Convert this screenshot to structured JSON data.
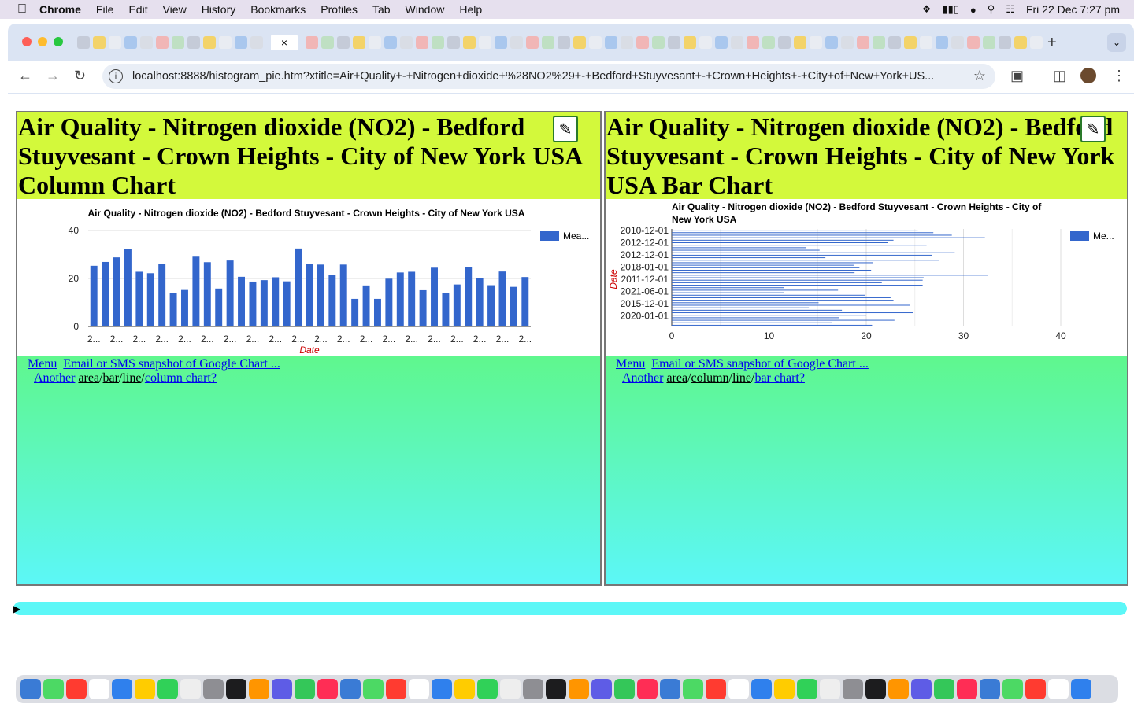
{
  "menubar": {
    "app": "Chrome",
    "items": [
      "File",
      "Edit",
      "View",
      "History",
      "Bookmarks",
      "Profiles",
      "Tab",
      "Window",
      "Help"
    ],
    "clock": "Fri 22 Dec  7:27 pm"
  },
  "browser": {
    "url": "localhost:8888/histogram_pie.htm?xtitle=Air+Quality+-+Nitrogen+dioxide+%28NO2%29+-+Bedford+Stuyvesant+-+Crown+Heights+-+City+of+New+York+US...",
    "tab_close": "×",
    "new_tab": "+"
  },
  "left_panel": {
    "heading": "Air Quality - Nitrogen dioxide (NO2) - Bedford Stuyvesant - Crown Heights - City of New York USA Column Chart",
    "menu_link": "Menu",
    "email_link": "Email or SMS snapshot of Google Chart ...",
    "another_prefix": "Another",
    "alt_area": "area",
    "alt_bar": "bar",
    "alt_line": "line",
    "alt_last": "column chart?",
    "sep": "/"
  },
  "right_panel": {
    "heading": "Air Quality - Nitrogen dioxide (NO2) - Bedford Stuyvesant - Crown Heights - City of New York USA Bar Chart",
    "menu_link": "Menu",
    "email_link": "Email or SMS snapshot of Google Chart ...",
    "another_prefix": "Another",
    "alt_area": "area",
    "alt_column": "column",
    "alt_line": "line",
    "alt_last": "bar chart?",
    "sep": "/"
  },
  "colors": {
    "bar": "#3366cc",
    "title_bg": "#d3f93b",
    "axis_label": "#cc0000"
  },
  "chart_data": [
    {
      "type": "bar",
      "orientation": "vertical",
      "title": "Air Quality - Nitrogen dioxide (NO2) - Bedford Stuyvesant - Crown Heights - City of New York USA",
      "xlabel": "Date",
      "ylabel": "",
      "ylim": [
        0,
        40
      ],
      "yticks": [
        0,
        20,
        40
      ],
      "tick_label": "2...",
      "legend": "Mea...",
      "legend_position": "right",
      "values": [
        25.3,
        26.9,
        28.8,
        32.2,
        22.8,
        22.2,
        26.2,
        13.8,
        15.2,
        29.1,
        26.8,
        15.8,
        27.5,
        20.7,
        18.7,
        19.3,
        20.5,
        18.8,
        32.5,
        25.9,
        25.8,
        21.6,
        25.8,
        11.5,
        17.1,
        11.5,
        19.9,
        22.5,
        22.8,
        15.1,
        24.5,
        14.1,
        17.5,
        24.8,
        20.0,
        17.2,
        22.9,
        16.5,
        20.6
      ],
      "grid": true
    },
    {
      "type": "bar",
      "orientation": "horizontal",
      "title": "Air Quality - Nitrogen dioxide (NO2) - Bedford Stuyvesant - Crown Heights - City of New York USA",
      "ylabel": "Date",
      "xlabel": "",
      "xlim": [
        0,
        40
      ],
      "xticks": [
        0,
        10,
        20,
        30,
        40
      ],
      "category_labels": [
        "2010-12-01",
        "2012-12-01",
        "2012-12-01",
        "2018-01-01",
        "2011-12-01",
        "2021-06-01",
        "2015-12-01",
        "2020-01-01"
      ],
      "legend": "Me...",
      "legend_position": "right",
      "values": [
        25.3,
        26.9,
        28.8,
        32.2,
        22.8,
        22.2,
        26.2,
        13.8,
        15.2,
        29.1,
        26.8,
        15.8,
        27.5,
        20.7,
        18.7,
        19.3,
        20.5,
        18.8,
        32.5,
        25.9,
        25.8,
        21.6,
        25.8,
        11.5,
        17.1,
        11.5,
        19.9,
        22.5,
        22.8,
        15.1,
        24.5,
        14.1,
        17.5,
        24.8,
        20.0,
        17.2,
        22.9,
        16.5,
        20.6
      ],
      "grid": true
    }
  ]
}
